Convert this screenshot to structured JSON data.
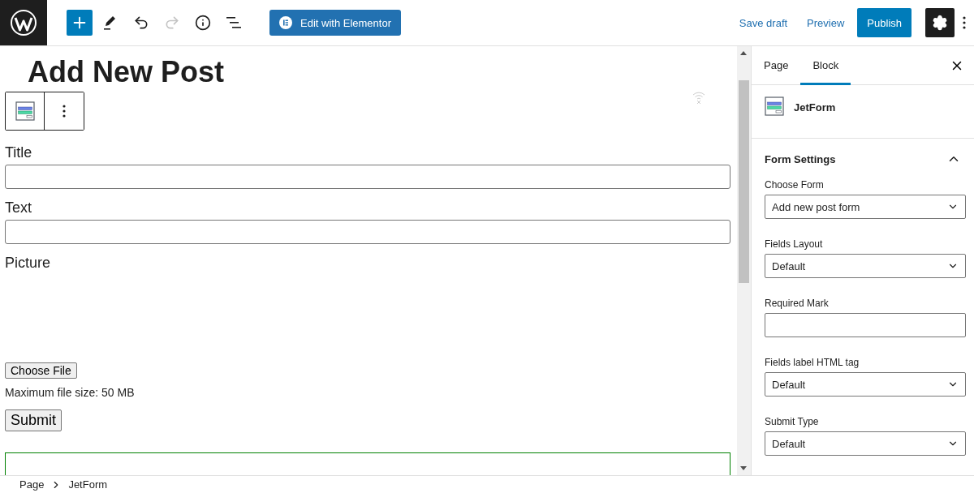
{
  "top_bar": {
    "tools": [
      {
        "kind": "add"
      },
      {
        "kind": "edit"
      },
      {
        "kind": "undo",
        "disabled": false
      },
      {
        "kind": "redo",
        "disabled": true
      },
      {
        "kind": "info"
      },
      {
        "kind": "outline"
      }
    ],
    "elementor_button": "Edit with Elementor",
    "save_draft": "Save draft",
    "preview": "Preview",
    "publish": "Publish",
    "settings": {
      "selected": true
    }
  },
  "editor": {
    "title": "Add New Post",
    "fields": [
      {
        "kind": "text",
        "label": "Title"
      },
      {
        "kind": "text",
        "label": "Text"
      },
      {
        "kind": "file",
        "label": "Picture",
        "button": "Choose File",
        "note": "Maximum file size: 50 MB"
      }
    ],
    "submit": "Submit"
  },
  "sidebar": {
    "tabs": [
      {
        "label": "Page",
        "selected": false
      },
      {
        "label": "Block",
        "selected": true
      }
    ],
    "block": {
      "name": "JetForm"
    },
    "panel": {
      "title": "Form Settings",
      "expanded": true,
      "fields": [
        {
          "kind": "select",
          "label": "Choose Form",
          "value": "Add new post form"
        },
        {
          "kind": "select",
          "label": "Fields Layout",
          "value": "Default"
        },
        {
          "kind": "text",
          "label": "Required Mark"
        },
        {
          "kind": "select",
          "label": "Fields label HTML tag",
          "value": "Default"
        },
        {
          "kind": "select",
          "label": "Submit Type",
          "value": "Default"
        }
      ]
    }
  },
  "breadcrumb": [
    "Page",
    "JetForm"
  ]
}
